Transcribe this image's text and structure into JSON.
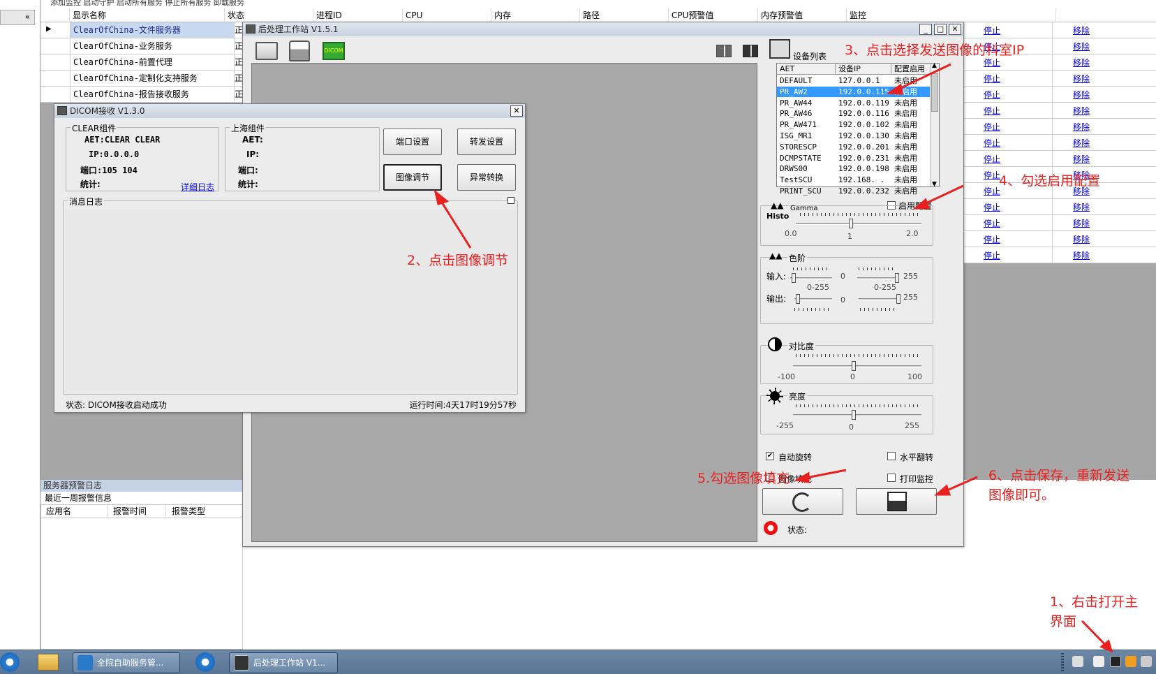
{
  "bg": {
    "top_menu": "添加监控  启动守护  启动所有服务  停止所有服务  卸载服务",
    "collapse_label": "«",
    "columns": [
      "显示名称",
      "状态",
      "进程ID",
      "CPU",
      "内存",
      "路径",
      "CPU预警值",
      "内存预警值",
      "监控"
    ],
    "rows": [
      {
        "name": "ClearOfChina-文件服务器",
        "status": "正"
      },
      {
        "name": "ClearOfChina-业务服务",
        "status": "正"
      },
      {
        "name": "ClearOfChina-前置代理",
        "status": "正"
      },
      {
        "name": "ClearOfChina-定制化支持服务",
        "status": "正"
      },
      {
        "name": "ClearOfChina-报告接收服务",
        "status": "正"
      }
    ],
    "stop_label": "停止",
    "remove_label": "移除",
    "alarm_header": "服务器预警日志",
    "alarm_sub": "最近一周报警信息",
    "alarm_cols": [
      "应用名",
      "报警时间",
      "报警类型"
    ]
  },
  "post_window": {
    "title": "后处理工作站 V1.5.1",
    "device_list_label": "设备列表",
    "device_cols": [
      "AET",
      "设备IP",
      "配置启用"
    ],
    "devices": [
      {
        "aet": "DEFAULT",
        "ip": "127.0.0.1",
        "enabled": "未启用"
      },
      {
        "aet": "PR_AW2",
        "ip": "192.0.0.115",
        "enabled": "未启用"
      },
      {
        "aet": "PR_AW44",
        "ip": "192.0.0.119",
        "enabled": "未启用"
      },
      {
        "aet": "PR_AW46",
        "ip": "192.0.0.116",
        "enabled": "未启用"
      },
      {
        "aet": "PR_AW471",
        "ip": "192.0.0.102",
        "enabled": "未启用"
      },
      {
        "aet": "ISG_MR1",
        "ip": "192.0.0.130",
        "enabled": "未启用"
      },
      {
        "aet": "STORESCP",
        "ip": "192.0.0.201",
        "enabled": "未启用"
      },
      {
        "aet": "DCMPSTATE",
        "ip": "192.0.0.231",
        "enabled": "未启用"
      },
      {
        "aet": "DRWS00",
        "ip": "192.0.0.198",
        "enabled": "未启用"
      },
      {
        "aet": "TestSCU",
        "ip": "192.168.   .",
        "enabled": "未启用"
      },
      {
        "aet": "PRINT_SCU",
        "ip": "192.0.0.232",
        "enabled": "未启用"
      }
    ],
    "enable_config_label": "启用配置",
    "histo_label": "Histo",
    "gamma_label": "Gamma",
    "gamma_min": "0.0",
    "gamma_val": "1",
    "gamma_max": "2.0",
    "levels_label": "色阶",
    "input_label": "输入:",
    "output_label": "输出:",
    "level_range": "0-255",
    "zero": "0",
    "max255": "255",
    "contrast_label": "对比度",
    "contrast_min": "-100",
    "contrast_mid": "0",
    "contrast_max": "100",
    "brightness_label": "亮度",
    "bright_min": "-255",
    "bright_mid": "0",
    "bright_max": "255",
    "auto_rotate": "自动旋转",
    "h_flip": "水平翻转",
    "fill_label": "图像填充",
    "print_monitor": "打印监控",
    "status_label": "状态:",
    "dicom_icon_text": "DICOM"
  },
  "dicom_window": {
    "title": "DICOM接收 V1.3.0",
    "clear_group": "CLEAR组件",
    "clear_aet": "AET:CLEAR CLEAR",
    "clear_ip": "IP:0.0.0.0",
    "clear_port": "端口:105 104",
    "clear_stats": "统计:",
    "detail_log": "详细日志",
    "sh_group": "上海组件",
    "sh_aet": "AET:",
    "sh_ip": "IP:",
    "sh_port": "端口:",
    "sh_stats": "统计:",
    "btn_port": "端口设置",
    "btn_forward": "转发设置",
    "btn_image": "图像调节",
    "btn_exception": "异常转换",
    "msg_log": "消息日志",
    "status_text": "状态:  DICOM接收启动成功",
    "runtime": "运行时间:4天17时19分57秒"
  },
  "taskbar": {
    "btn1": "全院自助服务管...",
    "btn2": "后处理工作站 V1..."
  },
  "annotations": {
    "a1": "1、右击打开主",
    "a1b": "界面",
    "a2": "2、点击图像调节",
    "a3": "3、点击选择发送图像的科室IP",
    "a4": "4、勾选启用配置",
    "a5": "5.勾选图像填充",
    "a6": "6、点击保存，重新发送",
    "a6b": "图像即可。"
  },
  "colors": {
    "annotation": "#e8201f",
    "selection": "#3399ff",
    "link": "#0000ee"
  }
}
